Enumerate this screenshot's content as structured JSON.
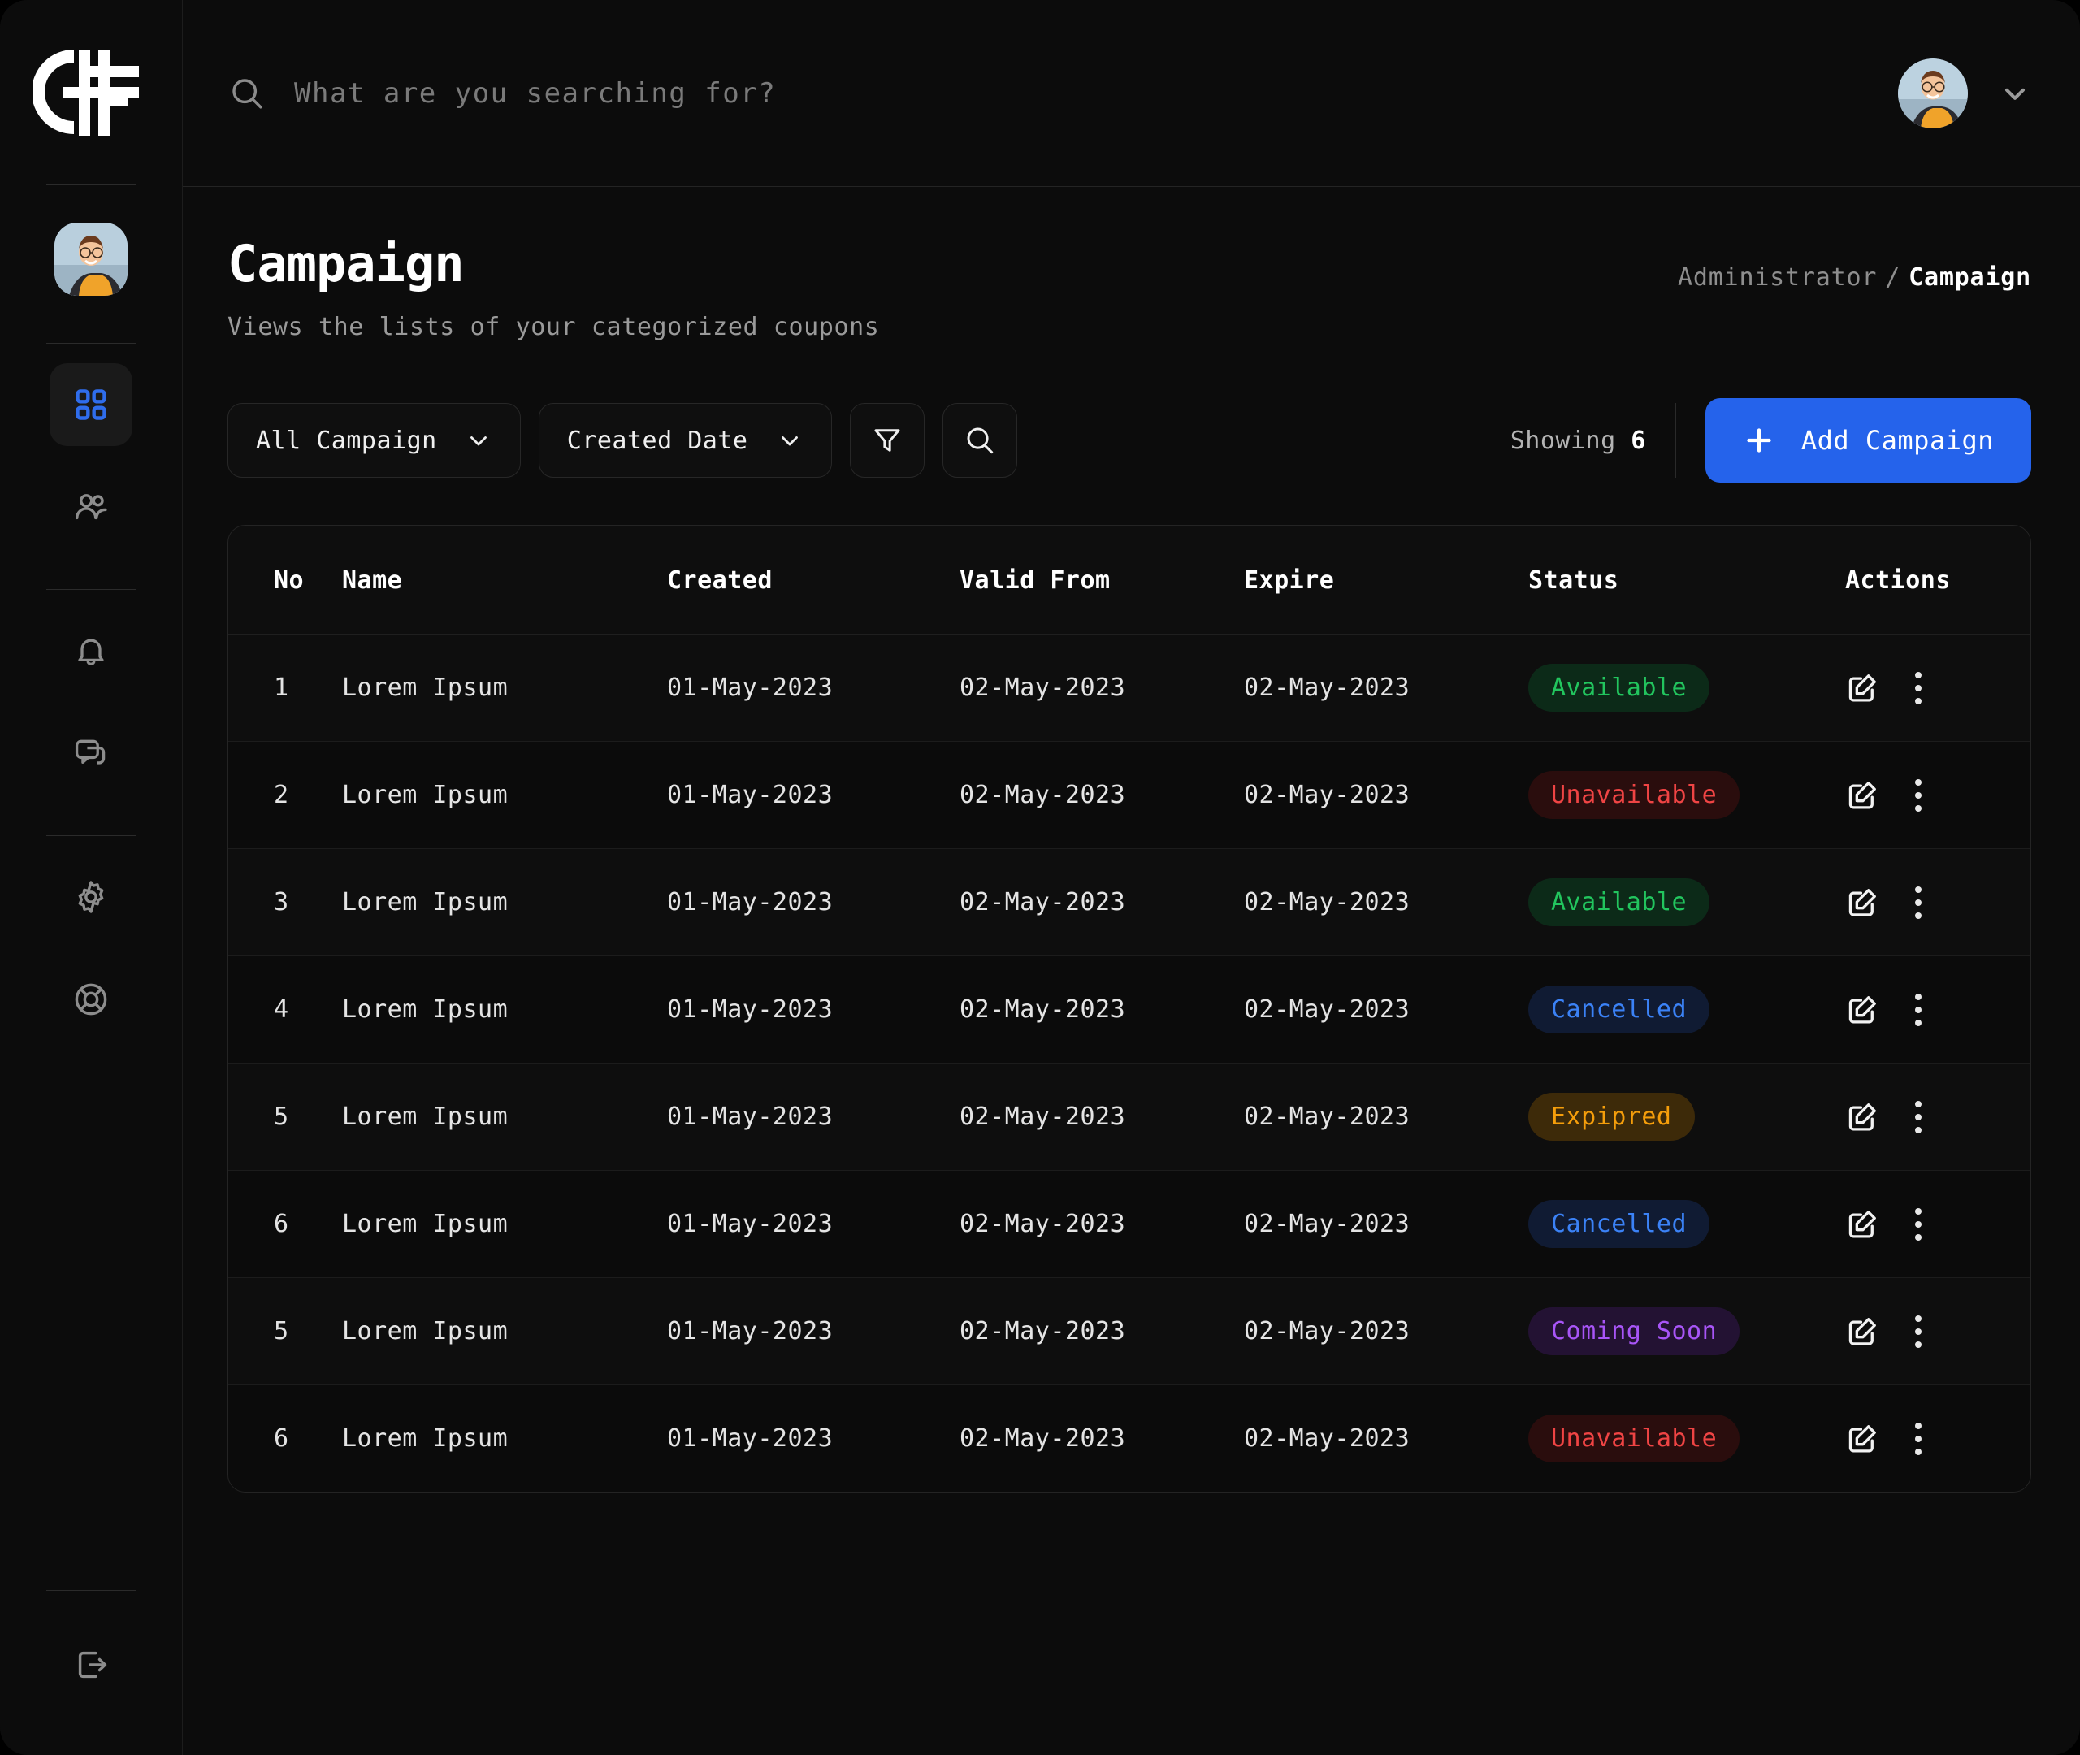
{
  "brand": {
    "logo_name": "cif-logo"
  },
  "sidebar": {
    "items": [
      {
        "name": "sidebar-item-dashboard",
        "icon": "grid-icon",
        "active": true
      },
      {
        "name": "sidebar-item-users",
        "icon": "users-icon",
        "active": false
      },
      {
        "name": "sidebar-item-notifications",
        "icon": "bell-icon",
        "active": false
      },
      {
        "name": "sidebar-item-messages",
        "icon": "chat-icon",
        "active": false
      },
      {
        "name": "sidebar-item-settings",
        "icon": "gear-icon",
        "active": false
      },
      {
        "name": "sidebar-item-support",
        "icon": "help-icon",
        "active": false
      }
    ],
    "logout": {
      "name": "sidebar-item-logout",
      "icon": "logout-icon"
    }
  },
  "topbar": {
    "search": {
      "placeholder": "What are you searching for?",
      "value": "",
      "icon": "search-icon"
    },
    "account": {
      "avatar": "user-avatar",
      "chevron": "chevron-down-icon"
    }
  },
  "page": {
    "title": "Campaign",
    "subtitle": "Views the lists of your categorized coupons",
    "breadcrumb": {
      "parent": "Administrator",
      "separator": "/",
      "current": "Campaign"
    }
  },
  "toolbar": {
    "campaign_filter": {
      "label": "All Campaign",
      "icon": "chevron-down-icon"
    },
    "date_filter": {
      "label": "Created Date",
      "icon": "chevron-down-icon"
    },
    "filter_button": {
      "icon": "funnel-icon"
    },
    "search_button": {
      "icon": "search-icon"
    },
    "showing_label": "Showing",
    "showing_count": "6",
    "add_button": {
      "label": "Add Campaign",
      "icon": "plus-icon"
    }
  },
  "table": {
    "columns": [
      "No",
      "Name",
      "Created",
      "Valid From",
      "Expire",
      "Status",
      "Actions"
    ],
    "rows": [
      {
        "no": "1",
        "name": "Lorem Ipsum",
        "created": "01-May-2023",
        "valid_from": "02-May-2023",
        "expire": "02-May-2023",
        "status": "Available",
        "status_class": "b-available"
      },
      {
        "no": "2",
        "name": "Lorem Ipsum",
        "created": "01-May-2023",
        "valid_from": "02-May-2023",
        "expire": "02-May-2023",
        "status": "Unavailable",
        "status_class": "b-unavailable"
      },
      {
        "no": "3",
        "name": "Lorem Ipsum",
        "created": "01-May-2023",
        "valid_from": "02-May-2023",
        "expire": "02-May-2023",
        "status": "Available",
        "status_class": "b-available"
      },
      {
        "no": "4",
        "name": "Lorem Ipsum",
        "created": "01-May-2023",
        "valid_from": "02-May-2023",
        "expire": "02-May-2023",
        "status": "Cancelled",
        "status_class": "b-cancelled"
      },
      {
        "no": "5",
        "name": "Lorem Ipsum",
        "created": "01-May-2023",
        "valid_from": "02-May-2023",
        "expire": "02-May-2023",
        "status": "Expipred",
        "status_class": "b-expired"
      },
      {
        "no": "6",
        "name": "Lorem Ipsum",
        "created": "01-May-2023",
        "valid_from": "02-May-2023",
        "expire": "02-May-2023",
        "status": "Cancelled",
        "status_class": "b-cancelled"
      },
      {
        "no": "5",
        "name": "Lorem Ipsum",
        "created": "01-May-2023",
        "valid_from": "02-May-2023",
        "expire": "02-May-2023",
        "status": "Coming Soon",
        "status_class": "b-coming"
      },
      {
        "no": "6",
        "name": "Lorem Ipsum",
        "created": "01-May-2023",
        "valid_from": "02-May-2023",
        "expire": "02-May-2023",
        "status": "Unavailable",
        "status_class": "b-unavailable"
      }
    ],
    "row_actions": {
      "edit_icon": "edit-square-icon",
      "more_icon": "more-vertical-icon"
    }
  },
  "colors": {
    "accent": "#2563eb",
    "available": "#22c55e",
    "unavailable": "#ef4444",
    "cancelled": "#3b82f6",
    "expired": "#f59e0b",
    "coming_soon": "#a855f7",
    "background": "#0c0c0c"
  }
}
